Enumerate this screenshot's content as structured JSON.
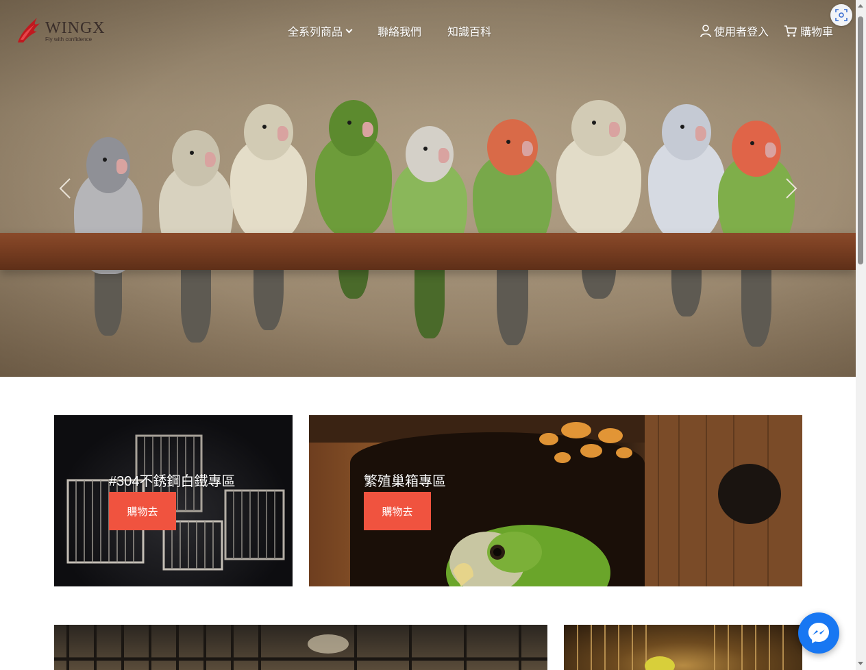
{
  "brand": {
    "name": "WINGX",
    "tagline": "Fly with confidence",
    "accent": "#f0533f"
  },
  "nav": {
    "menu": [
      {
        "label": "全系列商品",
        "has_dropdown": true
      },
      {
        "label": "聯絡我們"
      },
      {
        "label": "知識百科"
      }
    ],
    "login_label": "使用者登入",
    "cart_label": "購物車"
  },
  "hero": {
    "icons": [
      "chevron-left-icon",
      "chevron-right-icon"
    ]
  },
  "categories": [
    {
      "title": "#304不銹鋼白鐵專區",
      "button": "購物去"
    },
    {
      "title": "繁殖巢箱專區",
      "button": "購物去"
    }
  ],
  "messenger": {
    "icon": "messenger-icon",
    "color": "#1877f2"
  }
}
